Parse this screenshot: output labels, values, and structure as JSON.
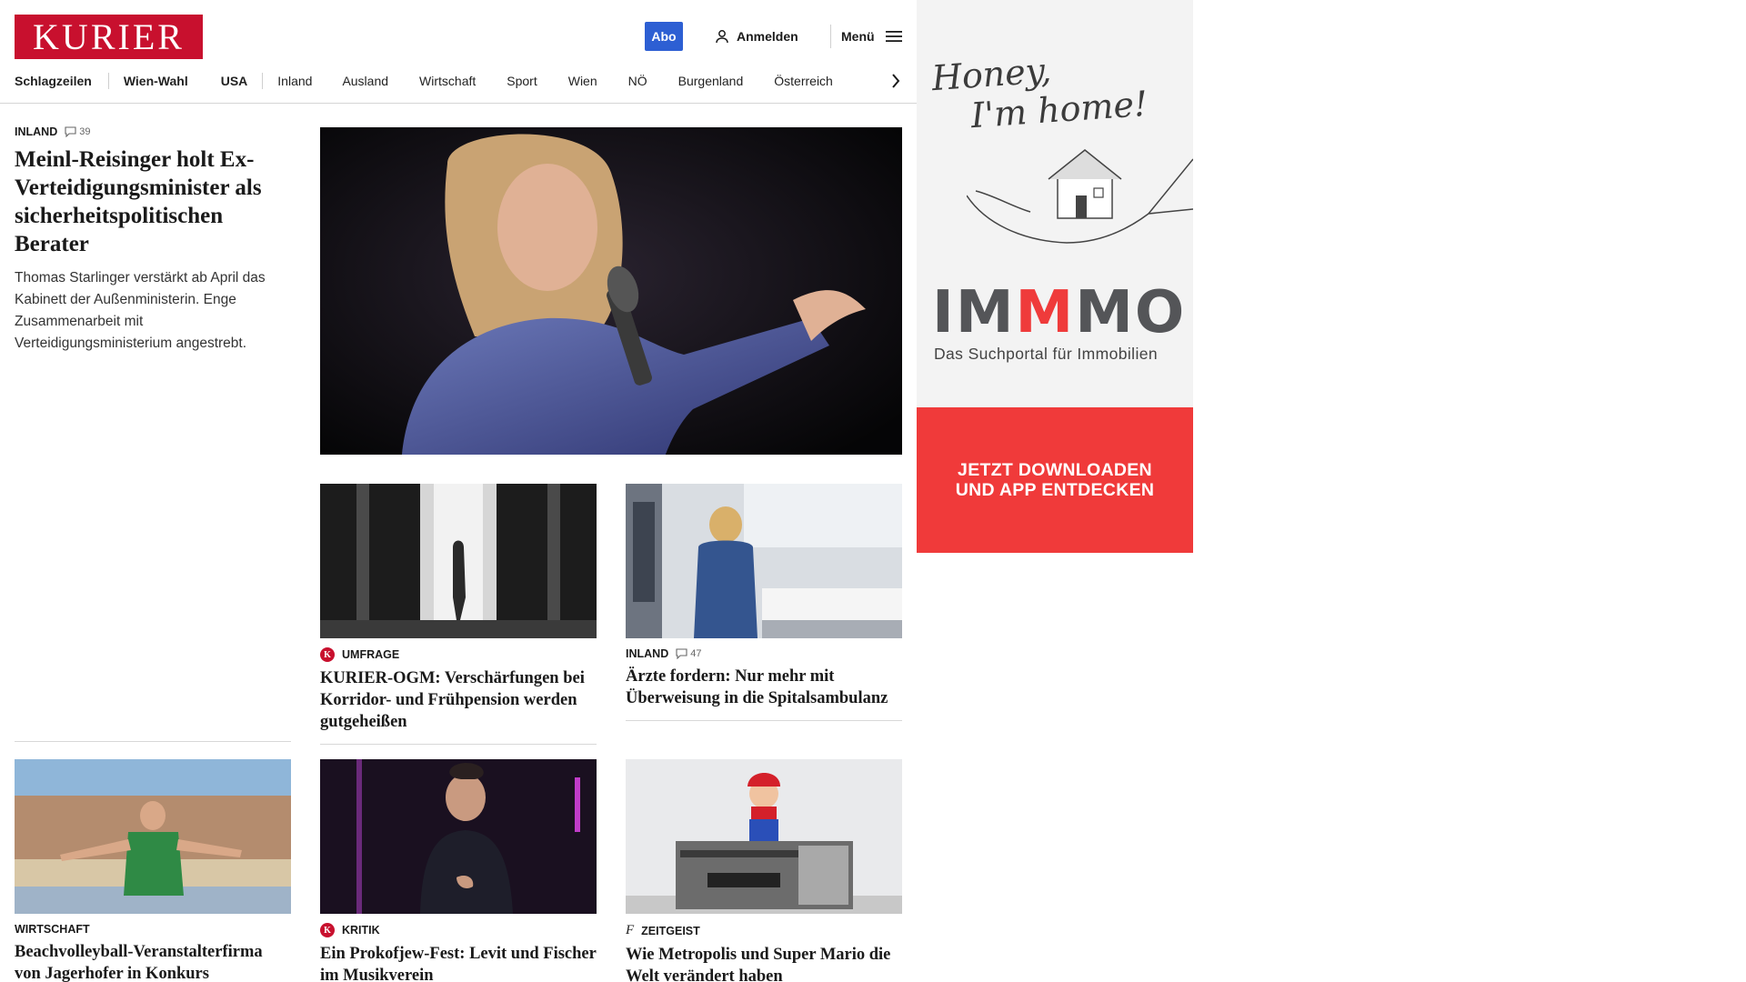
{
  "header": {
    "logo_text": "KURIER",
    "abo_label": "Abo",
    "login_label": "Anmelden",
    "menu_label": "Menü"
  },
  "nav": {
    "items": [
      "Schlagzeilen",
      "Wien-Wahl",
      "USA",
      "Inland",
      "Ausland",
      "Wirtschaft",
      "Sport",
      "Wien",
      "NÖ",
      "Burgenland",
      "Österreich"
    ]
  },
  "lead": {
    "category": "INLAND",
    "comments": "39",
    "title": "Meinl-Reisinger holt Ex-Verteidigungsminister als sicherheitspolitischen Berater",
    "teaser": "Thomas Starlinger verstärkt ab April das Kabinett der Außenministerin. Enge Zusammenarbeit mit Verteidigungsministerium angestrebt."
  },
  "cards": [
    {
      "category": "UMFRAGE",
      "badge": "K",
      "title": "KURIER-OGM: Verschärfungen bei Korridor- und Frühpension werden gutgeheißen"
    },
    {
      "category": "INLAND",
      "comments": "47",
      "title": "Ärzte fordern: Nur mehr mit Überweisung in die Spitalsambulanz"
    },
    {
      "category": "WIRTSCHAFT",
      "title": "Beachvolleyball-Veranstalterfirma von Jagerhofer in Konkurs"
    },
    {
      "category": "KRITIK",
      "badge": "K",
      "title": "Ein Prokofjew-Fest: Levit und Fischer im Musikverein"
    },
    {
      "category": "ZEITGEIST",
      "badge": "f",
      "title": "Wie Metropolis und Super Mario die Welt verändert haben"
    }
  ],
  "ad": {
    "script_line1": "Honey,",
    "script_line2": "I'm home!",
    "brand_part1": "IM",
    "brand_part2": "M",
    "brand_part3": "MO",
    "subtitle": "Das Suchportal für Immobilien",
    "cta_line1": "JETZT DOWNLOADEN",
    "cta_line2": "UND APP ENTDECKEN"
  },
  "colors": {
    "brand_red": "#c8102e",
    "abo_blue": "#2d5fd3",
    "ad_red": "#f03a3a"
  }
}
